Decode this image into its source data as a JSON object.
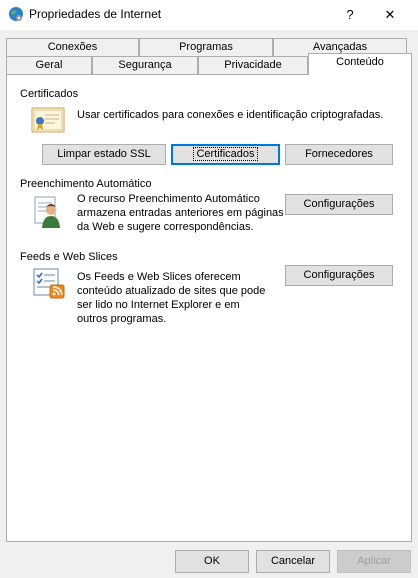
{
  "window": {
    "title": "Propriedades de Internet",
    "help": "?",
    "close": "✕"
  },
  "tabs_top": [
    "Conexões",
    "Programas",
    "Avançadas"
  ],
  "tabs_bottom": [
    "Geral",
    "Segurança",
    "Privacidade",
    "Conteúdo"
  ],
  "active_tab": "Conteúdo",
  "certificates": {
    "group_label": "Certificados",
    "description": "Usar certificados para conexões e identificação criptografadas.",
    "clear_ssl": "Limpar estado SSL",
    "certificates": "Certificados",
    "publishers": "Fornecedores"
  },
  "autocomplete": {
    "group_label": "Preenchimento Automático",
    "description_lines": [
      "O recurso Preenchimento Automático",
      "armazena entradas anteriores em páginas",
      "da Web e sugere correspondências."
    ],
    "settings": "Configurações"
  },
  "feeds": {
    "group_label": "Feeds e Web Slices",
    "description_lines": [
      "Os Feeds e Web Slices oferecem",
      "conteúdo atualizado de sites que pode",
      "ser lido no Internet Explorer e em",
      "outros programas."
    ],
    "settings": "Configurações"
  },
  "footer": {
    "ok": "OK",
    "cancel": "Cancelar",
    "apply": "Aplicar"
  },
  "colors": {
    "accent": "#0078d7",
    "panel": "#ffffff",
    "background": "#f0f0f0"
  },
  "icons": [
    "globe-icon",
    "certificate-icon",
    "autocomplete-user-icon",
    "feeds-icon"
  ]
}
